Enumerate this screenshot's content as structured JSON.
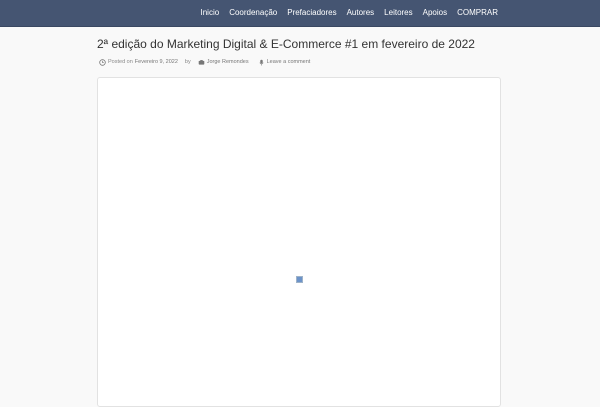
{
  "nav": {
    "items": [
      {
        "label": "Inicio"
      },
      {
        "label": "Coordenação"
      },
      {
        "label": "Prefaciadores"
      },
      {
        "label": "Autores"
      },
      {
        "label": "Leitores"
      },
      {
        "label": "Apoios"
      },
      {
        "label": "COMPRAR"
      }
    ]
  },
  "post": {
    "title": "2ª edição do Marketing Digital & E-Commerce #1 em fevereiro de 2022",
    "meta": {
      "posted_on_prefix": "Posted on",
      "date": "Fevereiro 9, 2022",
      "by_prefix": "by",
      "author": "Jorge Remondes",
      "comment_link": "Leave a comment"
    }
  },
  "icons": {
    "clock": "clock-icon",
    "author": "author-icon",
    "comment": "comment-icon",
    "broken_image": "broken-image-icon"
  },
  "colors": {
    "nav_background": "#455572",
    "page_background": "#f9f9f9",
    "title_text": "#333333",
    "meta_text": "#888888"
  }
}
